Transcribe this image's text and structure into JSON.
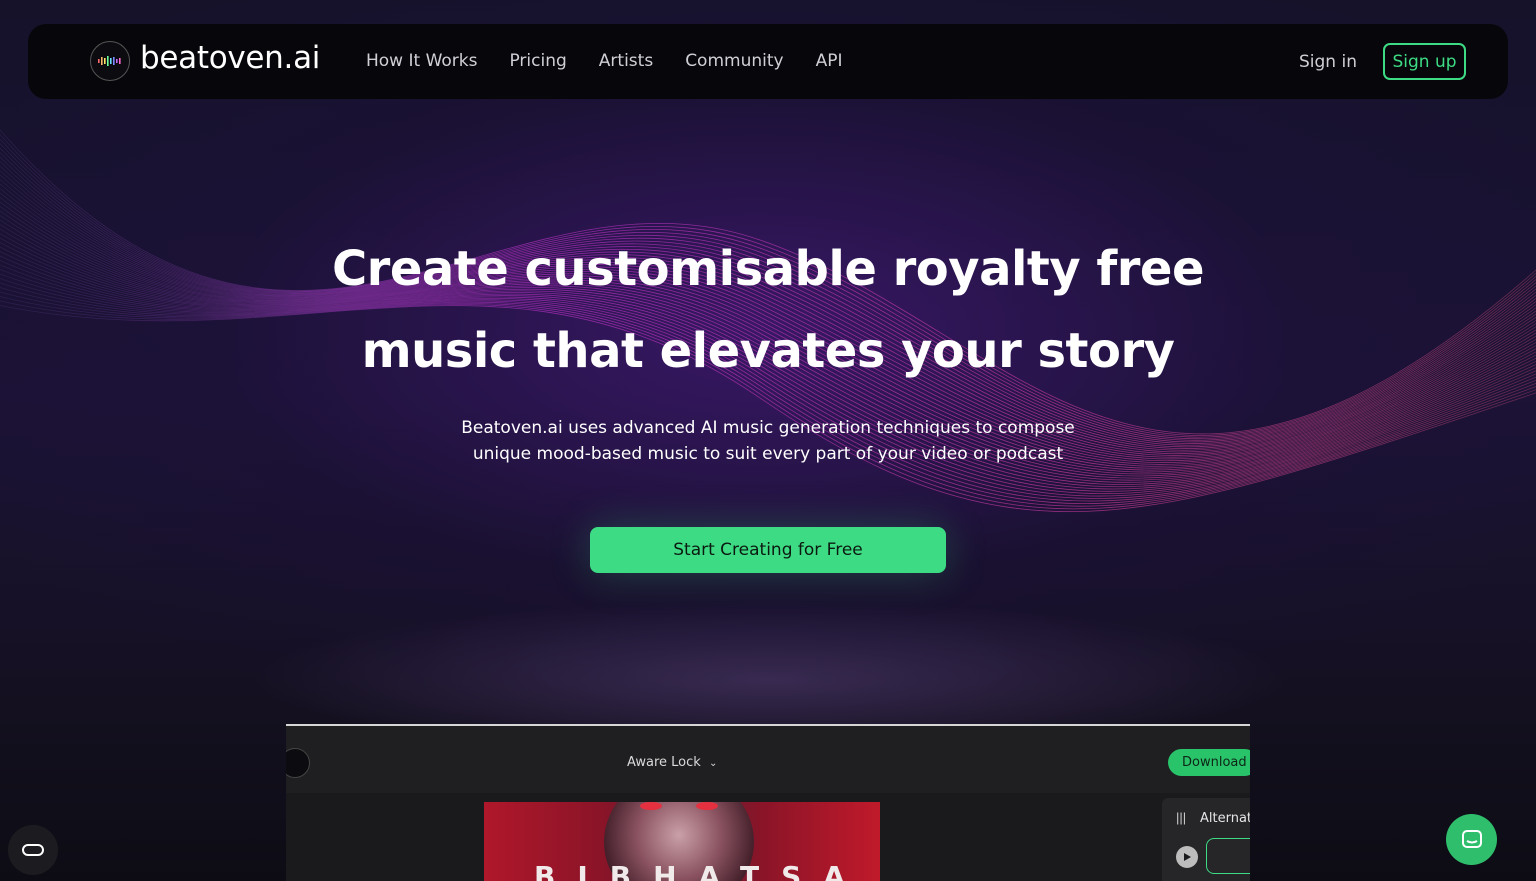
{
  "brand": {
    "name": "beatoven.ai",
    "logo_icon": "waveform-logo-icon"
  },
  "nav": {
    "links": [
      "How It Works",
      "Pricing",
      "Artists",
      "Community",
      "API"
    ],
    "sign_in": "Sign in",
    "sign_up": "Sign up"
  },
  "hero": {
    "headline_line1": "Create customisable royalty free",
    "headline_line2": "music that elevates your story",
    "subtitle": "Beatoven.ai uses advanced AI music generation techniques to compose unique mood-based music to suit every part of your video or podcast",
    "cta": "Start Creating for Free"
  },
  "preview": {
    "track_title": "Aware Lock",
    "download": "Download",
    "cover_text": "BIBHATSA",
    "side_label": "Alternate"
  },
  "colors": {
    "accent": "#3ddc84",
    "nav_bg": "#07070b",
    "page_bg": "#13111f"
  }
}
